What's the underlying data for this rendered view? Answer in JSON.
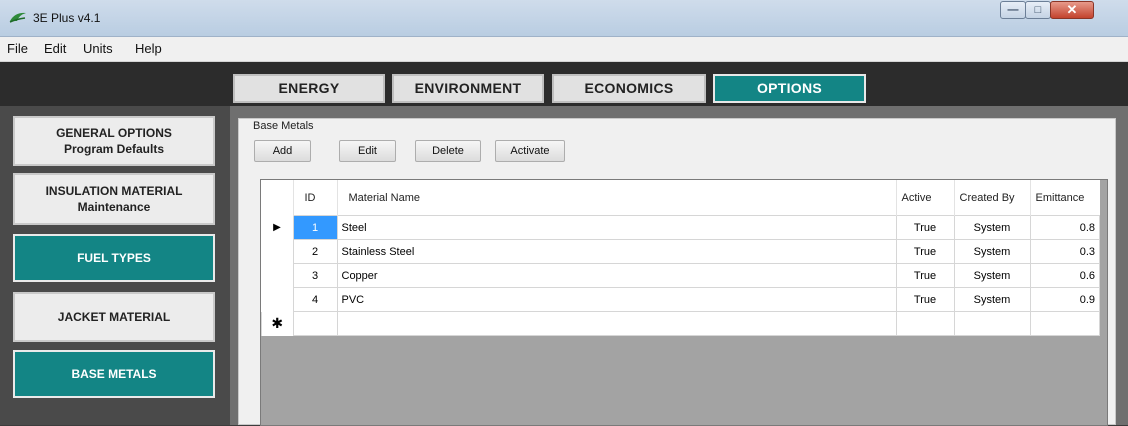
{
  "window": {
    "title": "3E Plus v4.1",
    "icon": "3e-plus-logo-icon",
    "controls": [
      "minimize-icon",
      "maximize-icon",
      "close-icon"
    ]
  },
  "menu": {
    "items": [
      "File",
      "Edit",
      "Units",
      "Help"
    ]
  },
  "tabs": {
    "items": [
      "ENERGY",
      "ENVIRONMENT",
      "ECONOMICS",
      "OPTIONS"
    ],
    "active": "OPTIONS"
  },
  "sidebar": {
    "general": {
      "line1": "GENERAL OPTIONS",
      "line2": "Program Defaults"
    },
    "insulation": {
      "line1": "INSULATION MATERIAL",
      "line2": "Maintenance"
    },
    "fuel": {
      "label": "FUEL TYPES"
    },
    "jacket": {
      "label": "JACKET MATERIAL"
    },
    "base": {
      "label": "BASE METALS"
    }
  },
  "group": {
    "title": "Base Metals",
    "buttons": {
      "add": "Add",
      "edit": "Edit",
      "delete": "Delete",
      "activate": "Activate"
    }
  },
  "grid": {
    "columns": [
      "ID",
      "Material Name",
      "Active",
      "Created By",
      "Emittance"
    ],
    "rows": [
      [
        "1",
        "Steel",
        "True",
        "System",
        "0.8"
      ],
      [
        "2",
        "Stainless Steel",
        "True",
        "System",
        "0.3"
      ],
      [
        "3",
        "Copper",
        "True",
        "System",
        "0.6"
      ],
      [
        "4",
        "PVC",
        "True",
        "System",
        "0.9"
      ]
    ],
    "current_row_marker": "▶",
    "new_row_marker": "✱"
  },
  "colors": {
    "accent_teal": "#138585",
    "selection_blue": "#3399ff"
  }
}
